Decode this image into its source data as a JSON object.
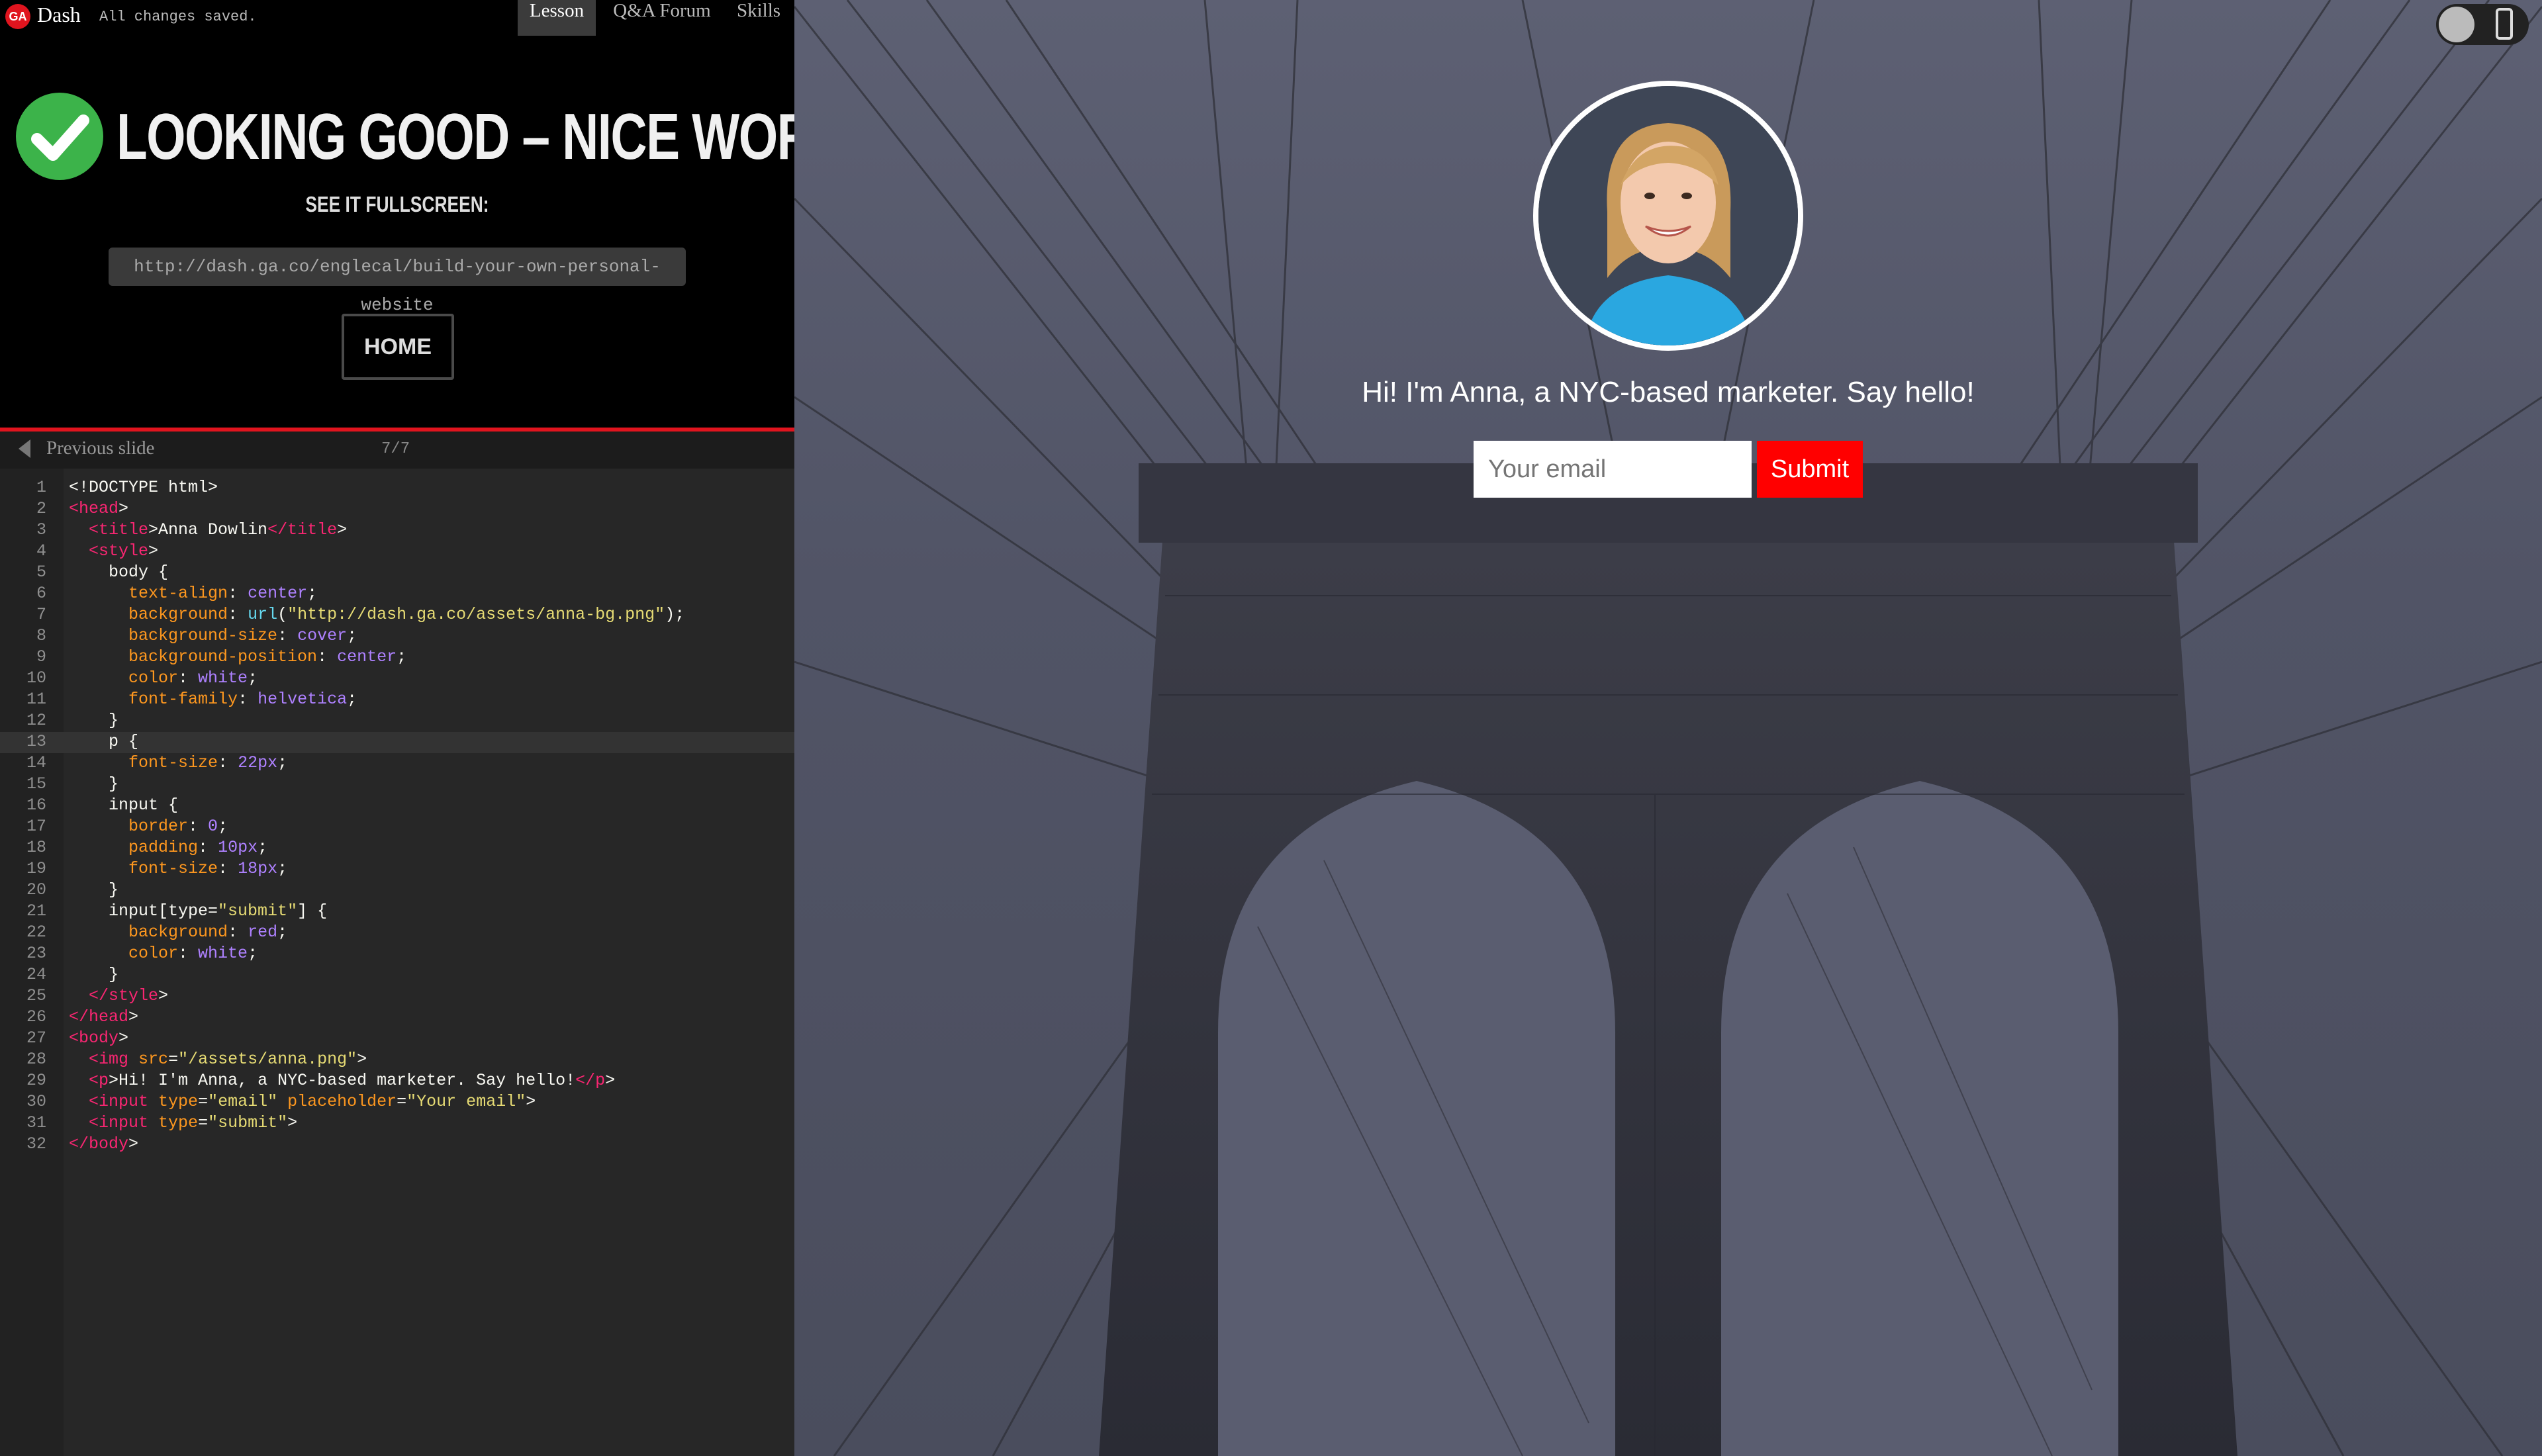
{
  "app": {
    "logo_text": "GA",
    "name": "Dash",
    "save_status": "All changes saved."
  },
  "tabs": [
    {
      "label": "Lesson",
      "active": true
    },
    {
      "label": "Q&A Forum",
      "active": false
    },
    {
      "label": "Skills",
      "active": false
    }
  ],
  "success": {
    "title": "LOOKING GOOD – NICE WORK!",
    "fullscreen_label": "SEE IT FULLSCREEN:",
    "url": "http://dash.ga.co/englecal/build-your-own-personal-website",
    "home_label": "HOME"
  },
  "slide_nav": {
    "prev_label": "Previous slide",
    "count": "7/7"
  },
  "editor": {
    "active_line": 13,
    "lines": [
      {
        "n": "1",
        "text": "<!DOCTYPE html>"
      },
      {
        "n": "2",
        "text": "<head>"
      },
      {
        "n": "3",
        "text": "  <title>Anna Dowlin</title>"
      },
      {
        "n": "4",
        "text": "  <style>"
      },
      {
        "n": "5",
        "text": "    body {"
      },
      {
        "n": "6",
        "text": "      text-align: center;"
      },
      {
        "n": "7",
        "text": "      background: url(\"http://dash.ga.co/assets/anna-bg.png\");"
      },
      {
        "n": "8",
        "text": "      background-size: cover;"
      },
      {
        "n": "9",
        "text": "      background-position: center;"
      },
      {
        "n": "10",
        "text": "      color: white;"
      },
      {
        "n": "11",
        "text": "      font-family: helvetica;"
      },
      {
        "n": "12",
        "text": "    }"
      },
      {
        "n": "13",
        "text": "    p {"
      },
      {
        "n": "14",
        "text": "      font-size: 22px;"
      },
      {
        "n": "15",
        "text": "    }"
      },
      {
        "n": "16",
        "text": "    input {"
      },
      {
        "n": "17",
        "text": "      border: 0;"
      },
      {
        "n": "18",
        "text": "      padding: 10px;"
      },
      {
        "n": "19",
        "text": "      font-size: 18px;"
      },
      {
        "n": "20",
        "text": "    }"
      },
      {
        "n": "21",
        "text": "    input[type=\"submit\"] {"
      },
      {
        "n": "22",
        "text": "      background: red;"
      },
      {
        "n": "23",
        "text": "      color: white;"
      },
      {
        "n": "24",
        "text": "    }"
      },
      {
        "n": "25",
        "text": "  </style>"
      },
      {
        "n": "26",
        "text": "</head>"
      },
      {
        "n": "27",
        "text": "<body>"
      },
      {
        "n": "28",
        "text": "  <img src=\"/assets/anna.png\">"
      },
      {
        "n": "29",
        "text": "  <p>Hi! I'm Anna, a NYC-based marketer. Say hello!</p>"
      },
      {
        "n": "30",
        "text": "  <input type=\"email\" placeholder=\"Your email\">"
      },
      {
        "n": "31",
        "text": "  <input type=\"submit\">"
      },
      {
        "n": "32",
        "text": "</body>"
      }
    ]
  },
  "preview": {
    "intro": "Hi! I'm Anna, a NYC-based marketer. Say hello!",
    "email_placeholder": "Your email",
    "submit_label": "Submit"
  },
  "colors": {
    "brand_red": "#e0141e",
    "success_green": "#3cb34a",
    "submit_red": "#ff0000"
  }
}
